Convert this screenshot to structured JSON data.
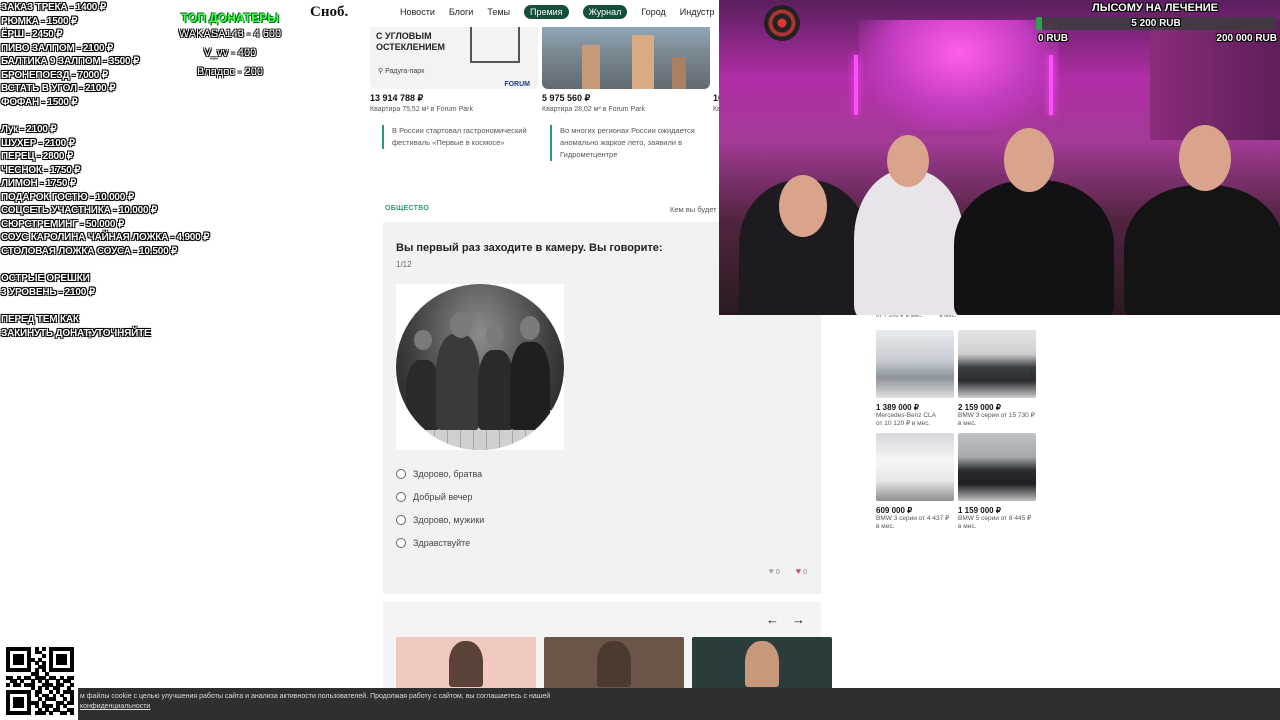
{
  "site": {
    "logo": "Сноб.",
    "nav": [
      "Новости",
      "Блоги",
      "Темы",
      "Премия",
      "Журнал",
      "Город",
      "Индустр"
    ],
    "nav_pills": [
      "Премия",
      "Журнал"
    ]
  },
  "listings": [
    {
      "promo": "С УГЛОВЫМ ОСТЕКЛЕНИЕМ",
      "location": "Радуга-парк",
      "brand": "FORUM",
      "price": "13 914 788 ₽",
      "desc": "Квартира 75,52 м² в Forum Park"
    },
    {
      "price": "5 975 560 ₽",
      "desc": "Квартира 28,02 м² в Forum Park"
    },
    {
      "price": "10",
      "desc": "Кв"
    }
  ],
  "news": [
    "В России стартовал гастрономический фестиваль «Первые в космосе»",
    "Во многих регионах России ожидается аномально жаркое лето, заявили в Гидрометцентре"
  ],
  "section": {
    "tag": "ОБЩЕСТВО",
    "right_text": "Кем вы будет"
  },
  "quiz": {
    "question": "Вы первый раз заходите в камеру. Вы говорите:",
    "counter": "1/12",
    "options": [
      "Здорово, братва",
      "Добрый вечер",
      "Здорово, мужики",
      "Здравствуйте"
    ],
    "likes": "0",
    "hearts": "0"
  },
  "carousel": {
    "prev": "←",
    "next": "→"
  },
  "cars": {
    "top_left": "от 7 206 ₽ в мес.",
    "top_right": "в мес.",
    "items": [
      {
        "price": "1 389 000 ₽",
        "model": "Mercedes-Benz CLA",
        "monthly": "от 10 120 ₽ в мес."
      },
      {
        "price": "2 159 000 ₽",
        "model": "BMW 3 серии от 15 730 ₽",
        "monthly": "в мес."
      },
      {
        "price": "609 000 ₽",
        "model": "BMW 3 серии от 4 437 ₽",
        "monthly": "в мес."
      },
      {
        "price": "1 159 000 ₽",
        "model": "BMW 5 серии от 8 445 ₽",
        "monthly": "в мес."
      }
    ]
  },
  "overlay": {
    "donate_blocks": [
      [
        "ЗАКАЗ ТРЕКА - 1400 ₽",
        "РЮМКА - 1500 ₽",
        "ЁРШ - 2450 ₽",
        "ПИВО ЗАЛПОМ - 2100 ₽",
        "БАЛТИКА 9 ЗАЛПОМ - 3500 ₽",
        "БРОНЕПОЕЗД - 7000 ₽",
        "ВСТАТЬ В УГОЛ - 2100 ₽",
        "ФОФАН - 1500 ₽"
      ],
      [
        "Лук - 2100 ₽",
        "ШУХЕР - 2100 ₽",
        "ПЕРЕЦ - 2800 ₽",
        "ЧЕСНОК - 1750 ₽",
        "ЛИМОН - 1750 ₽",
        "ПОДАРОК ГОСТЮ - 10.000 ₽",
        "СОЦСЕТЬ УЧАСТНИКА - 10.000 ₽",
        "СЮРСТРЕМИНГ - 50.000 ₽",
        "СОУС КАРОЛИНА ЧАЙНАЯ ЛОЖКА - 4.900 ₽",
        "СТОЛОВАЯ ЛОЖКА СОУСА - 10.500 ₽"
      ],
      [
        "ОСТРЫЕ ОРЕШКИ",
        "3 УРОВЕНЬ - 2100 ₽"
      ],
      [
        "ПЕРЕД ТЕМ КАК",
        "ЗАКИНУТЬ ДОНАТ,УТОЧНЯЙТЕ"
      ]
    ],
    "top_donors_title": "ТОП ДОНАТЕРЫ",
    "top_donors": [
      "WAKASA143 - 4 600",
      "V_vv - 400",
      "Владос - 200"
    ],
    "goal": {
      "title": "ЛЫСОМУ НА ЛЕЧЕНИЕ",
      "current": "5 200 RUB",
      "min": "0 RUB",
      "max": "200 000 RUB",
      "progress": 0.026
    }
  },
  "cookie": {
    "text": "м файлы cookie с целью улучшения работы сайта и анализа активности пользователей. Продолжая работу с сайтом, вы соглашаетесь с нашей",
    "link": "конфиденциальности"
  }
}
